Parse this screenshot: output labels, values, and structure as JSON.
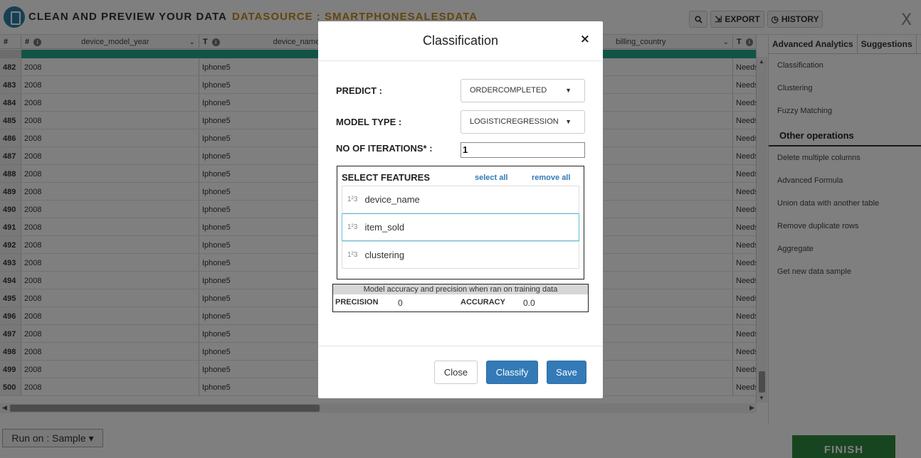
{
  "topbar": {
    "app_title": "CLEAN AND PREVIEW YOUR DATA",
    "datasource": "DATASOURCE : SMARTPHONESALESDATA",
    "export_label": "EXPORT",
    "history_label": "HISTORY",
    "close_symbol": "X"
  },
  "grid": {
    "columns": [
      {
        "type": "#",
        "name": "device_model_year"
      },
      {
        "type": "T",
        "name": "device_name"
      },
      {
        "type": "",
        "name": "billing_country"
      },
      {
        "type": "T",
        "name": ""
      }
    ],
    "rows": [
      {
        "n": "482",
        "year": "2008",
        "device": "Iphone5",
        "last": "Needs"
      },
      {
        "n": "483",
        "year": "2008",
        "device": "Iphone5",
        "last": "Needs"
      },
      {
        "n": "484",
        "year": "2008",
        "device": "Iphone5",
        "last": "Needs"
      },
      {
        "n": "485",
        "year": "2008",
        "device": "Iphone5",
        "last": "Needs"
      },
      {
        "n": "486",
        "year": "2008",
        "device": "Iphone5",
        "last": "Needs"
      },
      {
        "n": "487",
        "year": "2008",
        "device": "Iphone5",
        "last": "Needs"
      },
      {
        "n": "488",
        "year": "2008",
        "device": "Iphone5",
        "last": "Needs"
      },
      {
        "n": "489",
        "year": "2008",
        "device": "Iphone5",
        "last": "Needs"
      },
      {
        "n": "490",
        "year": "2008",
        "device": "Iphone5",
        "last": "Needs"
      },
      {
        "n": "491",
        "year": "2008",
        "device": "Iphone5",
        "last": "Needs"
      },
      {
        "n": "492",
        "year": "2008",
        "device": "Iphone5",
        "last": "Needs"
      },
      {
        "n": "493",
        "year": "2008",
        "device": "Iphone5",
        "last": "Needs"
      },
      {
        "n": "494",
        "year": "2008",
        "device": "Iphone5",
        "last": "Needs"
      },
      {
        "n": "495",
        "year": "2008",
        "device": "Iphone5",
        "last": "Needs"
      },
      {
        "n": "496",
        "year": "2008",
        "device": "Iphone5",
        "last": "Needs"
      },
      {
        "n": "497",
        "year": "2008",
        "device": "Iphone5",
        "last": "Needs"
      },
      {
        "n": "498",
        "year": "2008",
        "device": "Iphone5",
        "last": "Needs"
      },
      {
        "n": "499",
        "year": "2008",
        "device": "Iphone5",
        "last": "Needs"
      },
      {
        "n": "500",
        "year": "2008",
        "device": "Iphone5",
        "last": "Needs"
      }
    ]
  },
  "right_panel": {
    "tabs": [
      "Advanced Analytics",
      "Suggestions"
    ],
    "analytics_items": [
      "Classification",
      "Clustering",
      "Fuzzy Matching"
    ],
    "other_title": "Other operations",
    "other_items": [
      "Delete multiple columns",
      "Advanced Formula",
      "Union data with another table",
      "Remove duplicate rows",
      "Aggregate",
      "Get new data sample"
    ]
  },
  "bottom": {
    "run_on": "Run on : Sample",
    "finish": "FINISH"
  },
  "modal": {
    "title": "Classification",
    "close_symbol": "×",
    "predict_label": "PREDICT :",
    "predict_value": "ORDERCOMPLETED",
    "model_type_label": "MODEL TYPE :",
    "model_type_value": "LOGISTICREGRESSION",
    "iterations_label": "NO OF ITERATIONS* :",
    "iterations_value": "1",
    "features_title": "SELECT FEATURES",
    "select_all": "select all",
    "remove_all": "remove all",
    "features": [
      {
        "icon": "1²3",
        "name": "device_name",
        "selected": false
      },
      {
        "icon": "1²3",
        "name": "item_sold",
        "selected": true
      },
      {
        "icon": "1²3",
        "name": "clustering",
        "selected": false
      }
    ],
    "accuracy": {
      "heading": "Model accuracy and precision when ran on training data",
      "precision_label": "PRECISION",
      "precision_value": "0",
      "accuracy_label": "ACCURACY",
      "accuracy_value": "0.0"
    },
    "buttons": {
      "close": "Close",
      "classify": "Classify",
      "save": "Save"
    }
  },
  "colors": {
    "teal_bar": "#22a88a",
    "primary_button": "#337ab7",
    "finish_button": "#2e8b3e",
    "datasource_text": "#c58a1a"
  }
}
